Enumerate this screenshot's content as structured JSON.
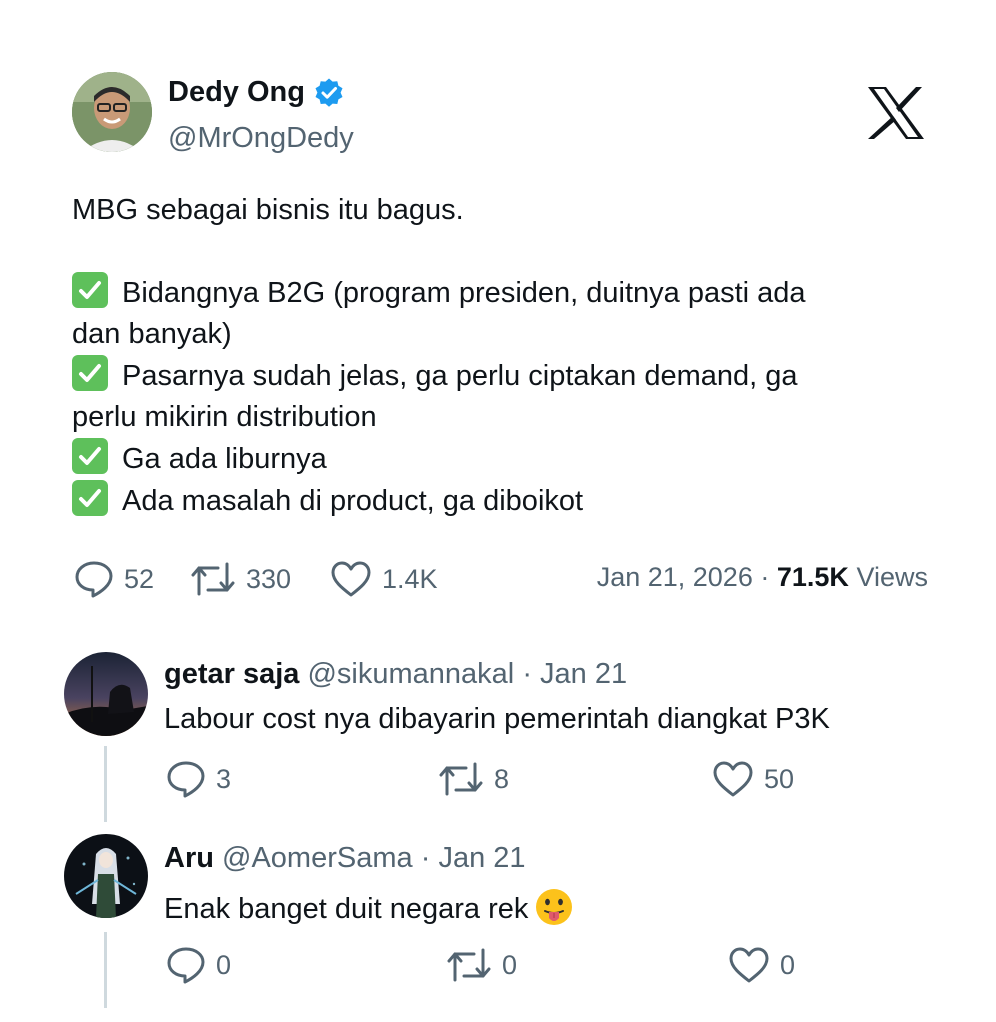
{
  "tweet": {
    "author_name": "Dedy Ong",
    "author_handle": "@MrOngDedy",
    "lines": {
      "l1": "MBG sebagai bisnis itu bagus.",
      "l2": "Bidangnya B2G (program presiden, duitnya pasti ada",
      "l2b": "dan banyak)",
      "l3": "Pasarnya sudah jelas, ga perlu ciptakan demand, ga",
      "l3b": "perlu mikirin distribution",
      "l4": "Ga ada liburnya",
      "l5": "Ada masalah di product, ga diboikot"
    },
    "replies_count": "52",
    "retweets_count": "330",
    "likes_count": "1.4K",
    "date": "Jan 21, 2026",
    "separator": "·",
    "views_count": "71.5K",
    "views_label": "Views"
  },
  "replies": [
    {
      "name": "getar saja",
      "handle": "@sikumannakal",
      "date": "Jan 21",
      "text": "Labour cost nya dibayarin pemerintah diangkat P3K",
      "reply_count": "3",
      "retweet_count": "8",
      "like_count": "50"
    },
    {
      "name": "Aru",
      "handle": "@AomerSama",
      "date": "Jan 21",
      "text": "Enak banget duit negara rek",
      "reply_count": "0",
      "retweet_count": "0",
      "like_count": "0"
    }
  ],
  "colors": {
    "text_primary": "#0f1419",
    "text_secondary": "#536471",
    "verified_blue": "#1d9bf0",
    "check_green": "#5ec05b",
    "thread_line": "#cfd9de"
  },
  "icons": [
    "verified-badge-icon",
    "x-logo-icon",
    "check-mark-icon",
    "reply-icon",
    "retweet-icon",
    "like-icon",
    "face-with-tongue-emoji"
  ]
}
